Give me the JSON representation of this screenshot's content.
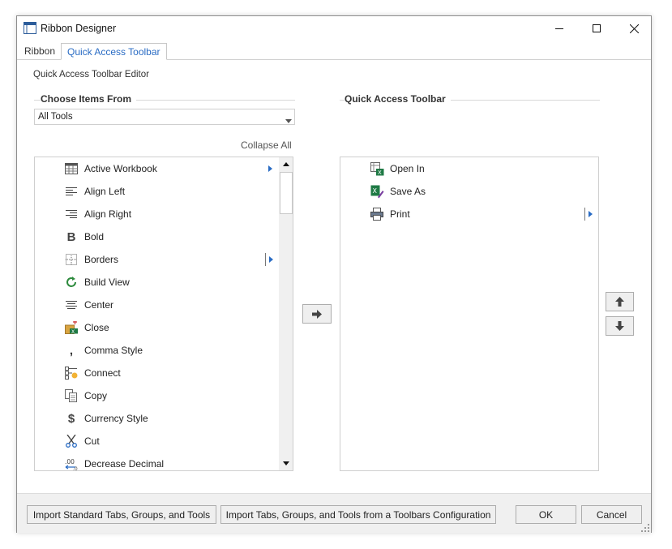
{
  "window": {
    "title": "Ribbon Designer",
    "controls": {
      "minimize": "minimize-icon",
      "maximize": "maximize-icon",
      "close": "close-icon"
    }
  },
  "tabs": [
    {
      "label": "Ribbon",
      "active": false
    },
    {
      "label": "Quick Access Toolbar",
      "active": true
    }
  ],
  "editor": {
    "heading": "Quick Access Toolbar Editor",
    "choose_items": {
      "title": "Choose Items From",
      "selected": "All Tools",
      "collapse_all": "Collapse All",
      "items": [
        {
          "label": "Active Workbook",
          "icon": "workbook-icon",
          "submenu": true,
          "selected": true
        },
        {
          "label": "Align Left",
          "icon": "align-left-icon"
        },
        {
          "label": "Align Right",
          "icon": "align-right-icon"
        },
        {
          "label": "Bold",
          "icon": "bold-icon"
        },
        {
          "label": "Borders",
          "icon": "borders-icon",
          "submenu": true
        },
        {
          "label": "Build View",
          "icon": "refresh-icon"
        },
        {
          "label": "Center",
          "icon": "align-center-icon"
        },
        {
          "label": "Close",
          "icon": "close-workbook-icon"
        },
        {
          "label": "Comma Style",
          "icon": "comma-icon"
        },
        {
          "label": "Connect",
          "icon": "connect-icon"
        },
        {
          "label": "Copy",
          "icon": "copy-icon"
        },
        {
          "label": "Currency Style",
          "icon": "dollar-icon"
        },
        {
          "label": "Cut",
          "icon": "scissors-icon"
        },
        {
          "label": "Decrease Decimal",
          "icon": "decrease-decimal-icon"
        }
      ]
    },
    "toolbar": {
      "title": "Quick Access Toolbar",
      "items": [
        {
          "label": "Open In",
          "icon": "open-in-excel-icon"
        },
        {
          "label": "Save As",
          "icon": "save-as-icon"
        },
        {
          "label": "Print",
          "icon": "printer-icon",
          "submenu": true
        }
      ]
    },
    "add_button": "arrow-right-icon",
    "move_up_button": "arrow-up-icon",
    "move_down_button": "arrow-down-icon"
  },
  "footer": {
    "import_standard": "Import Standard Tabs, Groups, and Tools",
    "import_config": "Import Tabs, Groups, and Tools from a Toolbars Configuration",
    "ok": "OK",
    "cancel": "Cancel"
  },
  "colors": {
    "accent": "#2a6cc4",
    "icon_gray": "#555555",
    "excel_green": "#1f7a45"
  }
}
